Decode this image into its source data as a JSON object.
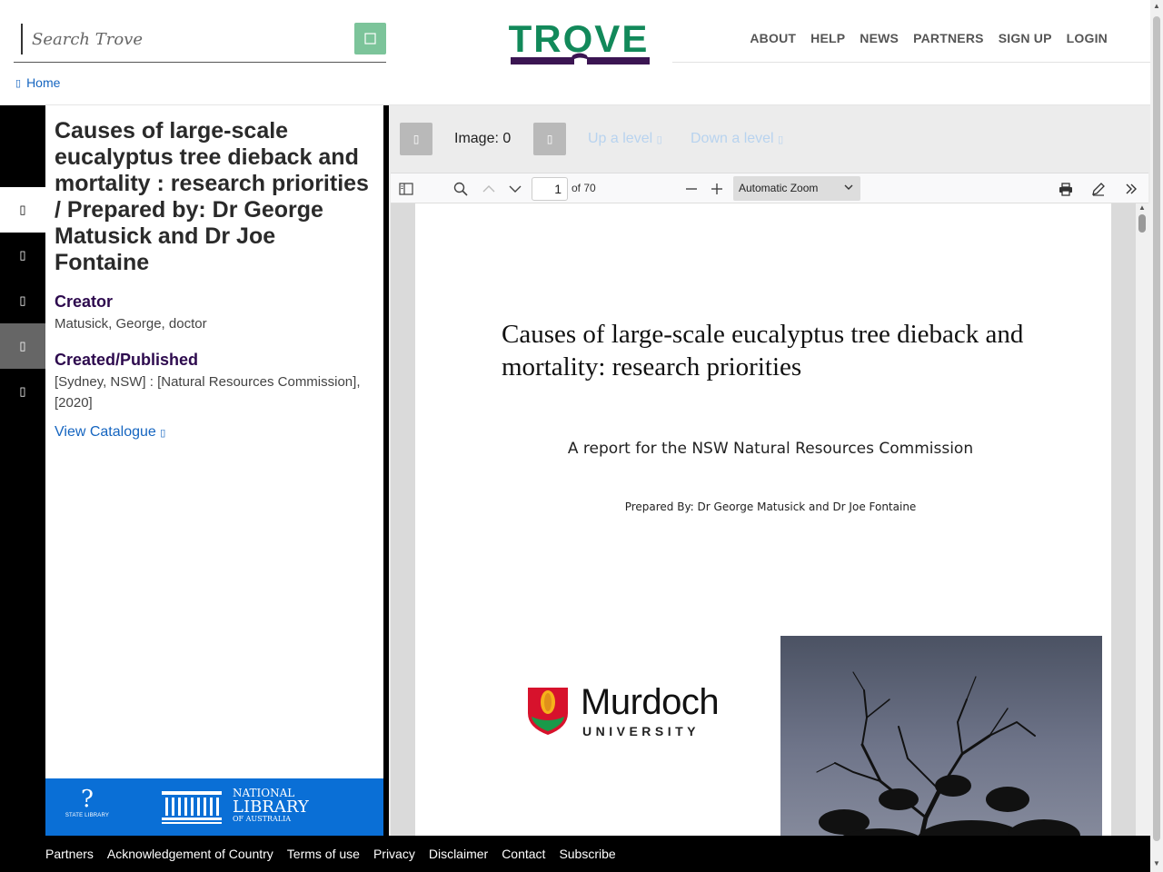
{
  "search": {
    "placeholder": "Search Trove",
    "button_icon": "search-icon"
  },
  "logo": {
    "text": "TROVE"
  },
  "nav": [
    {
      "label": "ABOUT"
    },
    {
      "label": "HELP"
    },
    {
      "label": "NEWS"
    },
    {
      "label": "PARTNERS"
    },
    {
      "label": "SIGN UP"
    },
    {
      "label": "LOGIN"
    }
  ],
  "breadcrumb": {
    "icon": "home-icon",
    "label": "Home"
  },
  "rail": [
    {
      "icon": "blank-icon",
      "state": "dark"
    },
    {
      "icon": "info-icon",
      "state": "active"
    },
    {
      "icon": "list-icon",
      "state": "dark"
    },
    {
      "icon": "cite-icon",
      "state": "dark"
    },
    {
      "icon": "share-icon",
      "state": "grey"
    },
    {
      "icon": "download-icon",
      "state": "dark"
    }
  ],
  "record": {
    "title": "Causes of large-scale eucalyptus tree dieback and mortality : research priorities / Prepared by: Dr George Matusick and Dr Joe Fontaine",
    "creator_label": "Creator",
    "creator_value": "Matusick, George, doctor",
    "published_label": "Created/Published",
    "published_value": "[Sydney, NSW] : [Natural Resources Commission], [2020]",
    "view_catalogue": "View Catalogue",
    "view_catalogue_icon": "external-link-icon"
  },
  "partners_band": {
    "state_library_mark": "?",
    "state_library_text": "STATE LIBRARY",
    "nla_line1": "NATIONAL",
    "nla_line2": "LIBRARY",
    "nla_line3": "OF AUSTRALIA"
  },
  "viewer": {
    "image_label": "Image: 0",
    "up_level": "Up a level",
    "down_level": "Down a level"
  },
  "pdf_toolbar": {
    "page_value": "1",
    "page_of": "of 70",
    "zoom": "Automatic Zoom"
  },
  "pdf_page": {
    "title": "Causes of large-scale eucalyptus tree dieback and mortality: research priorities",
    "subtitle": "A report for the NSW Natural Resources Commission",
    "prepared": "Prepared By:  Dr George Matusick and Dr Joe Fontaine",
    "murdoch_name": "Murdoch",
    "murdoch_university": "UNIVERSITY"
  },
  "footer": [
    {
      "label": "Partners"
    },
    {
      "label": "Acknowledgement of Country"
    },
    {
      "label": "Terms of use"
    },
    {
      "label": "Privacy"
    },
    {
      "label": "Disclaimer"
    },
    {
      "label": "Contact"
    },
    {
      "label": "Subscribe"
    }
  ],
  "colors": {
    "trove_green": "#12895a",
    "trove_purple": "#3b1552",
    "search_button": "#7cc49a",
    "link_blue": "#1565c0",
    "section_purple": "#2d0a4e",
    "partners_blue": "#0a6fd6"
  }
}
